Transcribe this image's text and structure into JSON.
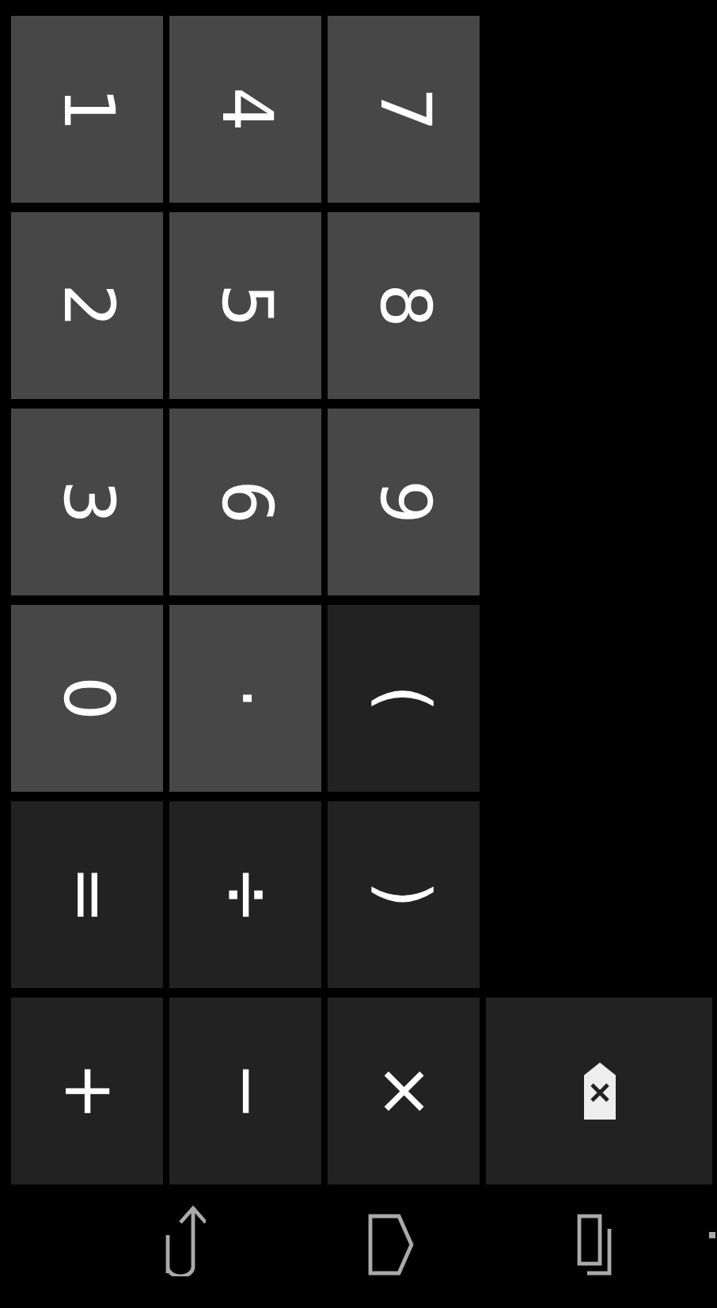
{
  "keypad": {
    "rows": [
      {
        "keys": [
          {
            "label": "1",
            "kind": "digit"
          },
          {
            "label": "4",
            "kind": "digit"
          },
          {
            "label": "7",
            "kind": "digit"
          }
        ]
      },
      {
        "keys": [
          {
            "label": "2",
            "kind": "digit"
          },
          {
            "label": "5",
            "kind": "digit"
          },
          {
            "label": "8",
            "kind": "digit"
          }
        ]
      },
      {
        "keys": [
          {
            "label": "3",
            "kind": "digit"
          },
          {
            "label": "6",
            "kind": "digit"
          },
          {
            "label": "9",
            "kind": "digit"
          }
        ]
      },
      {
        "keys": [
          {
            "label": "0",
            "kind": "digit"
          },
          {
            "label": "·",
            "kind": "digit"
          },
          {
            "label": "(",
            "kind": "operator"
          }
        ]
      },
      {
        "keys": [
          {
            "label": "=",
            "kind": "operator"
          },
          {
            "label": "÷",
            "kind": "operator"
          },
          {
            "label": ")",
            "kind": "operator"
          }
        ]
      },
      {
        "keys": [
          {
            "label": "+",
            "kind": "operator"
          },
          {
            "label": "−",
            "kind": "operator"
          },
          {
            "label": "×",
            "kind": "operator"
          },
          {
            "kind": "backspace"
          }
        ]
      }
    ]
  }
}
